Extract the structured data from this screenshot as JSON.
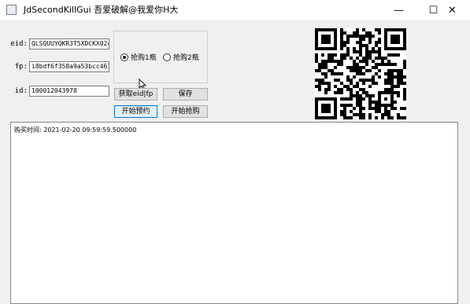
{
  "window": {
    "title": "JdSecondKillGui 吾爱破解@我爱你H大",
    "minimize_glyph": "—",
    "maximize_glyph": "☐",
    "close_glyph": "✕"
  },
  "form": {
    "eid_label": "eid:",
    "eid_value": "QLSQUUYQKR3T5XDCKX024",
    "fp_label": "fp:",
    "fp_value": "i8bdf6f358a9a53bcc461",
    "id_label": "id:",
    "id_value": "100012043978"
  },
  "radio_group": {
    "options": [
      {
        "label": "抢购1瓶",
        "checked": true
      },
      {
        "label": "抢购2瓶",
        "checked": false
      }
    ]
  },
  "buttons": {
    "get_eid_fp": "获取eid|fp",
    "save": "保存",
    "start_reserve": "开始预约",
    "start_buy": "开始抢购"
  },
  "qr": {
    "icon": "qr-code"
  },
  "log": {
    "lines": [
      "购买时间: 2021-02-20 09:59:59.500000"
    ]
  }
}
